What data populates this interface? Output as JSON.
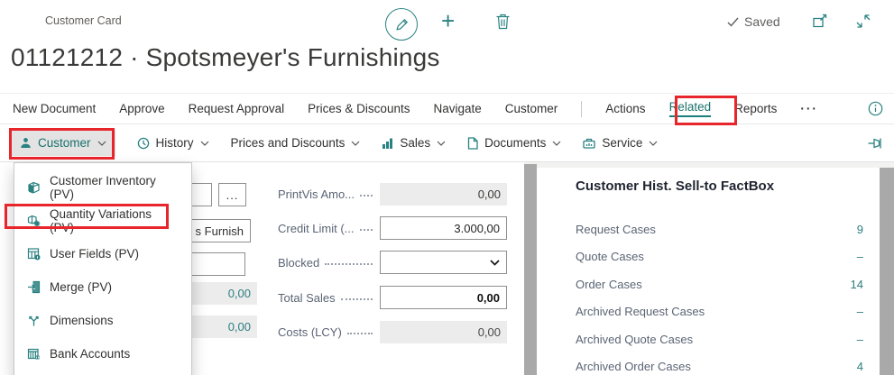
{
  "topbar": {
    "caption": "Customer Card",
    "saved": "Saved"
  },
  "title": "01121212 · Spotsmeyer's Furnishings",
  "menubar": {
    "items": [
      "New Document",
      "Approve",
      "Request Approval",
      "Prices & Discounts",
      "Navigate",
      "Customer"
    ],
    "actions": "Actions",
    "related": "Related",
    "reports": "Reports",
    "overflow": "···"
  },
  "ribbon": {
    "customer": "Customer",
    "history": "History",
    "prices": "Prices and Discounts",
    "sales": "Sales",
    "documents": "Documents",
    "service": "Service"
  },
  "dropdown": {
    "items": [
      {
        "label": "Customer Inventory (PV)",
        "icon": "inventory-icon"
      },
      {
        "label": "Quantity Variations (PV)",
        "icon": "quantity-variations-icon"
      },
      {
        "label": "User Fields (PV)",
        "icon": "user-fields-icon"
      },
      {
        "label": "Merge (PV)",
        "icon": "merge-icon"
      },
      {
        "label": "Dimensions",
        "icon": "dimensions-icon"
      },
      {
        "label": "Bank Accounts",
        "icon": "bank-accounts-icon"
      }
    ]
  },
  "form": {
    "assist": "...",
    "name_fragment": "s Furnish",
    "left_values": [
      "0,00",
      "0,00"
    ],
    "fields": [
      {
        "label": "PrintVis Amo...",
        "value": "0,00"
      },
      {
        "label": "Credit Limit (...",
        "value": "3.000,00"
      },
      {
        "label": "Blocked",
        "value": ""
      },
      {
        "label": "Total Sales",
        "value": "0,00"
      },
      {
        "label": "Costs (LCY)",
        "value": "0,00"
      }
    ]
  },
  "factbox": {
    "title": "Customer Hist. Sell-to FactBox",
    "rows": [
      {
        "label": "Request Cases",
        "value": "9"
      },
      {
        "label": "Quote Cases",
        "value": "–"
      },
      {
        "label": "Order Cases",
        "value": "14"
      },
      {
        "label": "Archived Request Cases",
        "value": "–"
      },
      {
        "label": "Archived Quote Cases",
        "value": "–"
      },
      {
        "label": "Archived Order Cases",
        "value": "4"
      }
    ]
  },
  "colors": {
    "accent": "#19716d",
    "icon_teal": "#2a8181",
    "annotation_red": "#e7252b",
    "link": "#2e7e80"
  }
}
